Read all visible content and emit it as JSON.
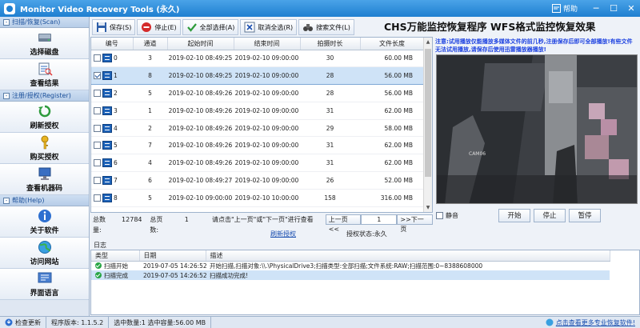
{
  "window": {
    "title": "Monitor Video Recovery Tools (永久)",
    "help_label": "帮助",
    "minimize": "─",
    "maximize": "☐",
    "close": "✕"
  },
  "sidebar": {
    "sections": [
      {
        "title": "扫描/恢复(Scan)",
        "items": [
          "选择磁盘",
          "查看结果"
        ]
      },
      {
        "title": "注册/授权(Register)",
        "items": [
          "刷新授权",
          "购买授权",
          "查看机器码"
        ]
      },
      {
        "title": "帮助(Help)",
        "items": [
          "关于软件",
          "访问网站",
          "界面语言"
        ]
      }
    ]
  },
  "toolbar": {
    "save": "保存(S)",
    "stop": "停止(E)",
    "select_all": "全部选择(A)",
    "deselect_all": "取消全选(R)",
    "search_file": "搜索文件(L)"
  },
  "banner": "CHS万能监控恢复程序 WFS格式监控恢复效果",
  "table": {
    "headers": [
      "编号",
      "通道",
      "起始时间",
      "结束时间",
      "拍摄时长",
      "文件长度"
    ],
    "rows": [
      {
        "id": "0",
        "channel": "3",
        "start": "2019-02-10 08:49:25",
        "end": "2019-02-10 09:00:00",
        "duration": "30",
        "size": "60.00 MB",
        "checked": false,
        "selected": false
      },
      {
        "id": "1",
        "channel": "8",
        "start": "2019-02-10 08:49:25",
        "end": "2019-02-10 09:00:00",
        "duration": "28",
        "size": "56.00 MB",
        "checked": true,
        "selected": true
      },
      {
        "id": "2",
        "channel": "5",
        "start": "2019-02-10 08:49:26",
        "end": "2019-02-10 09:00:00",
        "duration": "28",
        "size": "56.00 MB",
        "checked": false,
        "selected": false
      },
      {
        "id": "3",
        "channel": "1",
        "start": "2019-02-10 08:49:26",
        "end": "2019-02-10 09:00:00",
        "duration": "31",
        "size": "62.00 MB",
        "checked": false,
        "selected": false
      },
      {
        "id": "4",
        "channel": "2",
        "start": "2019-02-10 08:49:26",
        "end": "2019-02-10 09:00:00",
        "duration": "29",
        "size": "58.00 MB",
        "checked": false,
        "selected": false
      },
      {
        "id": "5",
        "channel": "7",
        "start": "2019-02-10 08:49:26",
        "end": "2019-02-10 09:00:00",
        "duration": "31",
        "size": "62.00 MB",
        "checked": false,
        "selected": false
      },
      {
        "id": "6",
        "channel": "4",
        "start": "2019-02-10 08:49:26",
        "end": "2019-02-10 09:00:00",
        "duration": "31",
        "size": "62.00 MB",
        "checked": false,
        "selected": false
      },
      {
        "id": "7",
        "channel": "6",
        "start": "2019-02-10 08:49:27",
        "end": "2019-02-10 09:00:00",
        "duration": "26",
        "size": "52.00 MB",
        "checked": false,
        "selected": false
      },
      {
        "id": "8",
        "channel": "5",
        "start": "2019-02-10 09:00:00",
        "end": "2019-02-10 10:00:00",
        "duration": "158",
        "size": "316.00 MB",
        "checked": false,
        "selected": false
      }
    ]
  },
  "pager": {
    "total_label": "总数量:",
    "total_value": "12784",
    "pages_label": "总页数:",
    "pages_value": "1",
    "hint": "请点击\"上一页\"或\"下一页\"进行查看",
    "prev": "上一页<<",
    "page_input": "1",
    "next": ">>下一页"
  },
  "preview": {
    "notice": "注意:试用播放仅能播放多媒体文件的前几秒,注册保存后即可全部播放!有些文件无法试用播放,请保存后使用迅雷播放器播放!",
    "mute": "静音",
    "play": "开始",
    "stop": "停止",
    "pause": "暂停",
    "overlay": "CAM06"
  },
  "status_links": {
    "refresh": "刷新授权",
    "license": "授权状态:永久"
  },
  "log": {
    "label": "日志",
    "headers": [
      "类型",
      "日期",
      "描述"
    ],
    "rows": [
      {
        "type": "扫描开始",
        "date": "2019-07-05 14:26:52",
        "desc": "开始扫描,扫描对象:\\\\.\\PhysicalDrive3;扫描类型:全部扫描;文件系统:RAW;扫描范围:0~8388608000",
        "selected": false
      },
      {
        "type": "扫描完成",
        "date": "2019-07-05 14:26:52",
        "desc": "扫描成功完成!",
        "selected": true
      }
    ]
  },
  "statusbar": {
    "check_update": "检查更新",
    "version": "程序版本:  1.1.5.2",
    "selection": "选中数量:1 选中容量:56.00 MB",
    "more_link": "点击查看更多专业恢复软件!"
  },
  "colors": {
    "title_bg": "#1f7fd0",
    "accent": "#1a4fb0",
    "notice": "#1a3fe0",
    "selection": "#cfe3f7"
  }
}
